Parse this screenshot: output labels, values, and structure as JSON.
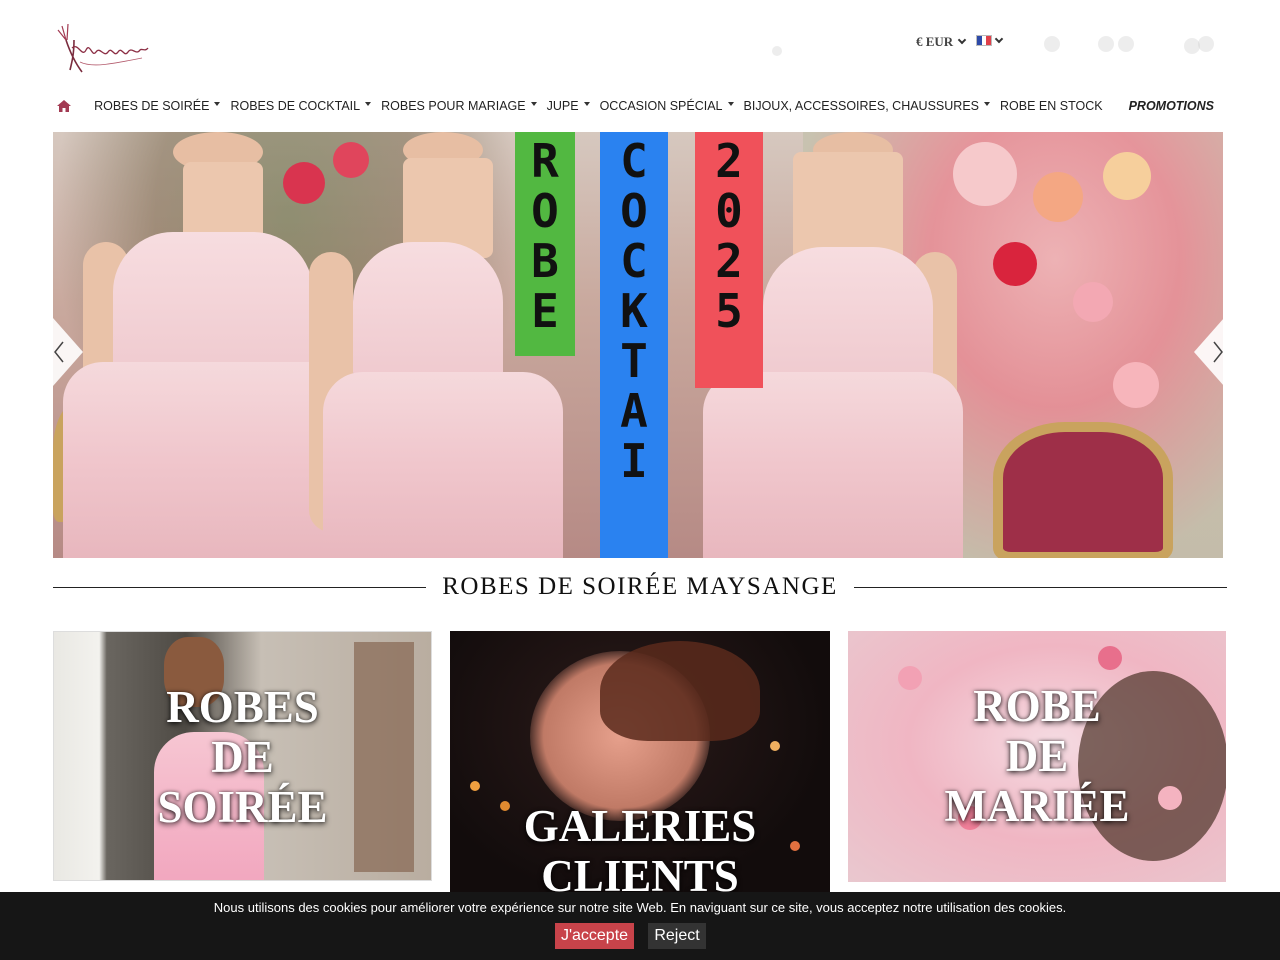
{
  "header": {
    "currency_label": "€ EUR",
    "language_flag": "fr-flag-icon",
    "icons": [
      "search-icon",
      "user-icon",
      "heart-icon",
      "cart-icon"
    ]
  },
  "nav": {
    "home_icon": "home-icon",
    "items": [
      {
        "label": "ROBES DE SOIRÉE",
        "has_dropdown": true
      },
      {
        "label": "ROBES DE COCKTAIL",
        "has_dropdown": true
      },
      {
        "label": "ROBES POUR MARIAGE",
        "has_dropdown": true
      },
      {
        "label": "JUPE",
        "has_dropdown": true
      },
      {
        "label": "OCCASION SPÉCIAL",
        "has_dropdown": true
      },
      {
        "label": "BIJOUX, ACCESSOIRES, CHAUSSURES",
        "has_dropdown": true
      },
      {
        "label": "ROBE EN STOCK",
        "has_dropdown": false
      }
    ],
    "promo_label": "PROMOTIONS"
  },
  "hero": {
    "banners": [
      {
        "text": "ROBE",
        "color": "#52b841"
      },
      {
        "text": "COCKTAI",
        "color": "#2a82f0"
      },
      {
        "text": "2025",
        "color": "#f0515a"
      }
    ],
    "prev_icon": "chevron-left-icon",
    "next_icon": "chevron-right-icon"
  },
  "section": {
    "title": "ROBES DE SOIRÉE MAYSANGE"
  },
  "cards": [
    {
      "lines": [
        "ROBES",
        "DE",
        "SOIRÉE"
      ]
    },
    {
      "lines": [
        "GALERIES",
        "CLIENTS"
      ]
    },
    {
      "lines": [
        "ROBE",
        "DE",
        "MARIÉE"
      ]
    }
  ],
  "cookie": {
    "message": "Nous utilisons des cookies pour améliorer votre expérience sur notre site Web. En naviguant sur ce site, vous acceptez notre utilisation des cookies.",
    "accept_label": "J'accepte",
    "reject_label": "Reject"
  },
  "colors": {
    "brand": "#a23a52",
    "accept": "#c8434a",
    "cookie_bg": "#161616"
  }
}
